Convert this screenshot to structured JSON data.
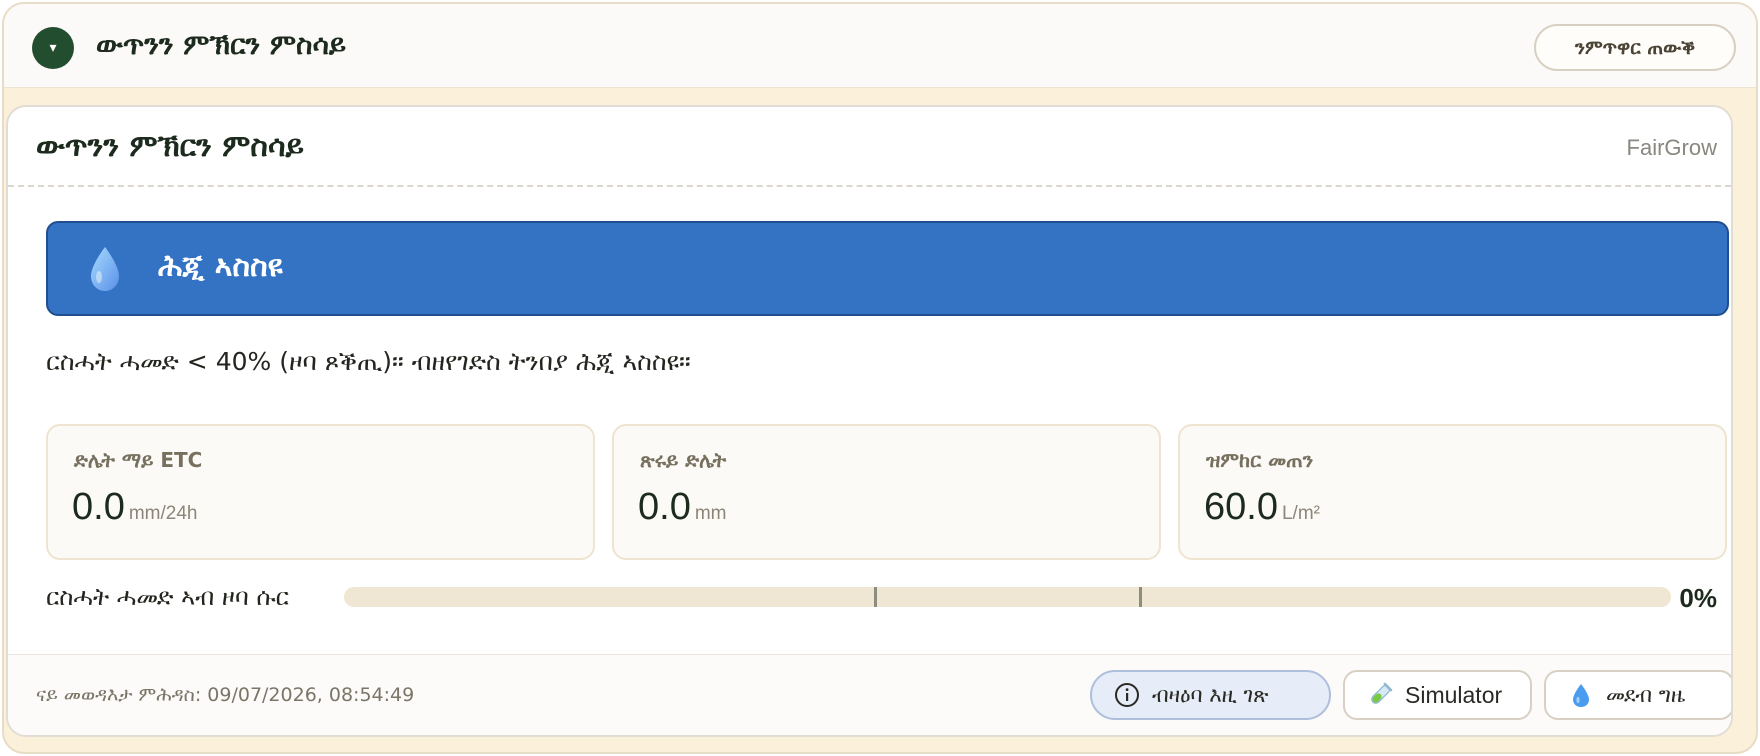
{
  "topbar": {
    "toggle_glyph": "▾",
    "title": "ውጥንን ምኽርን ምስሳይ",
    "hide_button_label": "ንምጥዋር ጠውቕ"
  },
  "card": {
    "title": "ውጥንን ምኽርን ምስሳይ",
    "brand": "FairGrow",
    "banner": {
      "icon": "water-drop-icon",
      "text": "ሕጂ ኣስስዩ",
      "color": "#3472c4"
    },
    "message": "ርስሓት ሓመድ < 40% (ዞባ ጾቕጢ)። ብዘየገድስ ትንበያ ሕጂ ኣስስዩ።",
    "metrics": [
      {
        "label": "ድሌት ማይ ETC",
        "value": "0.0",
        "unit": "mm/24h"
      },
      {
        "label": "ጽሩይ ድሌት",
        "value": "0.0",
        "unit": "mm"
      },
      {
        "label": "ዝምከር መጠን",
        "value": "60.0",
        "unit": "L/m²"
      }
    ],
    "progress": {
      "label": "ርስሓት ሓመድ ኣብ ዞባ ሱር",
      "percent_text": "0%",
      "fraction": 0.0
    },
    "footer": {
      "updated": "ናይ መወዳእታ ምሕዳስ: 09/07/2026, 08:54:49",
      "buttons": {
        "info_label": "ብዛዕባ እዚ ገጽ",
        "info_icon": "info-circle-icon",
        "simulator_label": "Simulator",
        "simulator_icon": "test-tube-icon",
        "irrigation_label": "መደብ ግዜ",
        "irrigation_icon": "water-drop-icon"
      }
    }
  }
}
